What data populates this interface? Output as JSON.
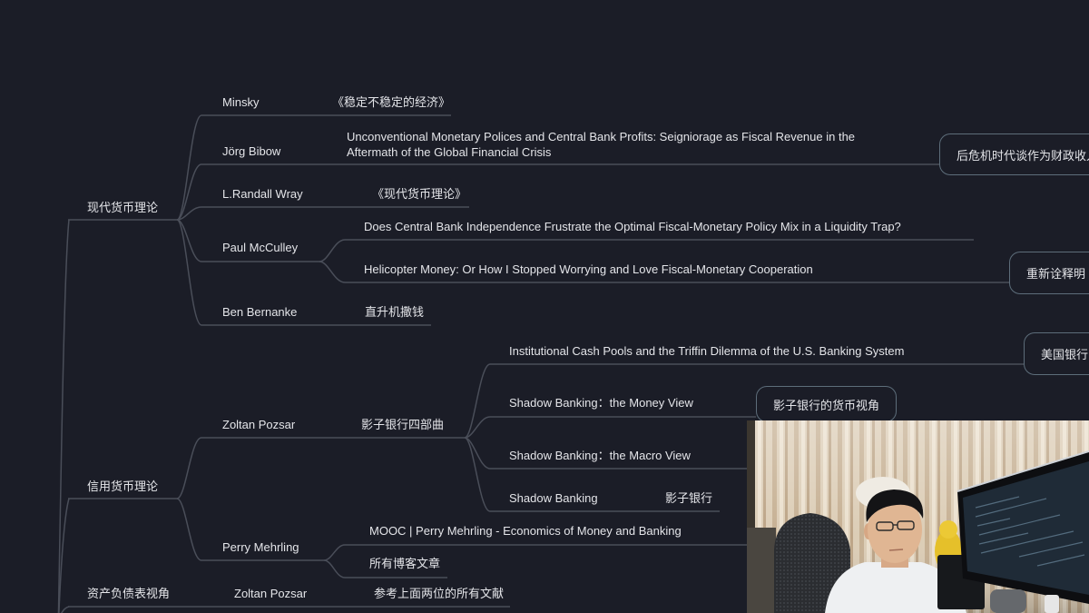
{
  "branches": [
    {
      "label": "现代货币理论",
      "authors": [
        {
          "name": "Minsky",
          "works": [
            {
              "title": "《稳定不稳定的经济》"
            }
          ]
        },
        {
          "name": "Jörg Bibow",
          "works": [
            {
              "title": "Unconventional Monetary Polices and Central Bank Profits: Seigniorage as Fiscal Revenue in the Aftermath of the Global Financial Crisis",
              "note": "后危机时代谈作为财政收入"
            }
          ]
        },
        {
          "name": "L.Randall Wray",
          "works": [
            {
              "title": "《现代货币理论》"
            }
          ]
        },
        {
          "name": "Paul McCulley",
          "works": [
            {
              "title": "Does Central Bank Independence Frustrate the Optimal Fiscal-Monetary Policy Mix in a Liquidity Trap?"
            },
            {
              "title": "Helicopter Money: Or How I Stopped Worrying and Love Fiscal-Monetary Cooperation",
              "note": "重新诠释明"
            }
          ]
        },
        {
          "name": "Ben Bernanke",
          "works": [
            {
              "title": "直升机撒钱"
            }
          ]
        }
      ]
    },
    {
      "label": "信用货币理论",
      "authors": [
        {
          "name": "Zoltan Pozsar",
          "works": [
            {
              "title": "影子银行四部曲",
              "papers": [
                {
                  "title": "Institutional Cash Pools and the Triffin Dilemma of the U.S. Banking System",
                  "note": "美国银行"
                },
                {
                  "title": "Shadow Banking：the Money View",
                  "note": "影子银行的货币视角"
                },
                {
                  "title": "Shadow Banking：the Macro View"
                },
                {
                  "title": "Shadow Banking",
                  "child": "影子银行"
                }
              ]
            }
          ]
        },
        {
          "name": "Perry Mehrling",
          "works": [
            {
              "title": "MOOC | Perry Mehrling - Economics of Money and Banking"
            },
            {
              "title": "所有博客文章"
            }
          ]
        }
      ]
    },
    {
      "label": "资产负债表视角",
      "authors": [
        {
          "name": "Zoltan Pozsar",
          "works": [
            {
              "title": "参考上面两位的所有文献"
            }
          ]
        }
      ]
    }
  ],
  "colors": {
    "background": "#1b1d27",
    "connector": "#4a4e59",
    "text": "#e4e5e9",
    "note_border": "#5d6d7a"
  }
}
